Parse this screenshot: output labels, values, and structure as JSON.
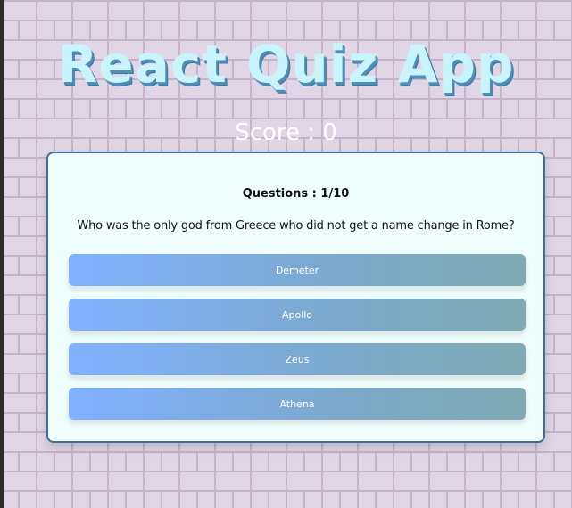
{
  "app": {
    "title": "React Quiz App",
    "score_text": "Score : 0"
  },
  "quiz": {
    "question_counter": "Questions : 1/10",
    "question": "Who was the only god from Greece who did not get a name change in Rome?",
    "answers": [
      {
        "label": "Demeter"
      },
      {
        "label": "Apollo"
      },
      {
        "label": "Zeus"
      },
      {
        "label": "Athena"
      }
    ]
  },
  "colors": {
    "title_fill": "#c9f4fb",
    "title_shadow": "#4d8fb8",
    "card_background": "#effdfd",
    "card_border": "#3f6d9a",
    "answer_gradient_start": "#82b1ff",
    "answer_gradient_end": "#7eaab2",
    "brick_background": "#e0d6e6",
    "brick_mortar": "#c7b3cc"
  }
}
